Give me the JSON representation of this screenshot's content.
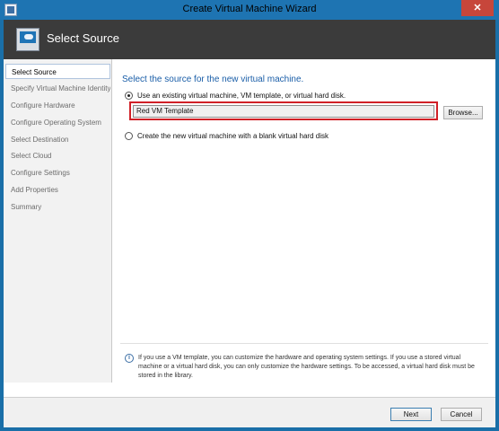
{
  "window": {
    "title": "Create Virtual Machine Wizard",
    "close_label": "✕"
  },
  "banner": {
    "title": "Select Source"
  },
  "nav": {
    "items": [
      {
        "label": "Select Source",
        "active": true
      },
      {
        "label": "Specify Virtual Machine Identity",
        "active": false
      },
      {
        "label": "Configure Hardware",
        "active": false
      },
      {
        "label": "Configure Operating System",
        "active": false
      },
      {
        "label": "Select Destination",
        "active": false
      },
      {
        "label": "Select Cloud",
        "active": false
      },
      {
        "label": "Configure Settings",
        "active": false
      },
      {
        "label": "Add Properties",
        "active": false
      },
      {
        "label": "Summary",
        "active": false
      }
    ]
  },
  "main": {
    "heading": "Select the source for the new virtual machine.",
    "option_existing": {
      "label": "Use an existing virtual machine, VM template, or virtual hard disk.",
      "selected": true
    },
    "source_field": {
      "value": "Red VM Template"
    },
    "browse_label": "Browse...",
    "option_blank": {
      "label": "Create the new virtual machine with a blank virtual hard disk",
      "selected": false
    },
    "info_text": "If you use a VM template, you can customize the hardware and operating system settings. If you use a stored virtual machine or a virtual hard disk, you can only customize the hardware settings. To be accessed, a virtual hard disk must be stored in the library."
  },
  "footer": {
    "next_label": "Next",
    "cancel_label": "Cancel"
  },
  "colors": {
    "title_bar": "#1e74b2",
    "banner": "#3b3b3b",
    "heading": "#1a5ea8",
    "highlight": "#d02027",
    "close": "#c7463b"
  },
  "icons": [
    "app-icon",
    "wizard-icon",
    "info-icon",
    "close-icon"
  ]
}
